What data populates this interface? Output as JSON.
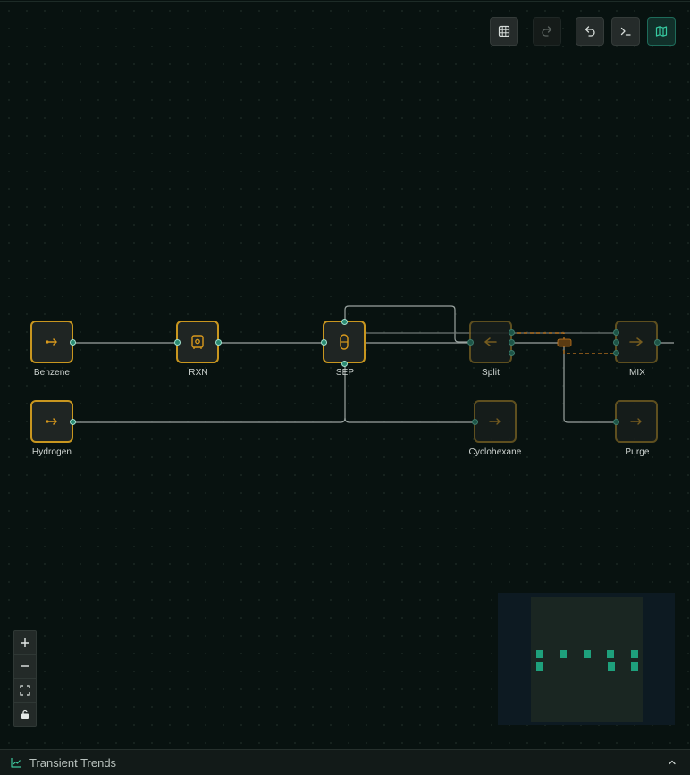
{
  "toolbar": {
    "buttons": [
      {
        "name": "grid-button",
        "icon": "grid-icon",
        "state": "normal"
      },
      {
        "name": "redo-button",
        "icon": "redo-icon",
        "state": "disabled"
      },
      {
        "name": "undo-button",
        "icon": "undo-icon",
        "state": "normal"
      },
      {
        "name": "console-button",
        "icon": "terminal-icon",
        "state": "normal"
      },
      {
        "name": "map-button",
        "icon": "map-icon",
        "state": "active"
      }
    ]
  },
  "nodes": {
    "benzene": {
      "label": "Benzene",
      "icon": "feed-arrow-icon"
    },
    "rxn": {
      "label": "RXN",
      "icon": "reactor-icon"
    },
    "sep": {
      "label": "SEP",
      "icon": "separator-icon"
    },
    "split": {
      "label": "Split",
      "icon": "splitter-icon"
    },
    "mix": {
      "label": "MIX",
      "icon": "mixer-icon"
    },
    "hydrogen": {
      "label": "Hydrogen",
      "icon": "feed-arrow-icon"
    },
    "cyclohexane": {
      "label": "Cyclohexane",
      "icon": "product-arrow-icon"
    },
    "purge": {
      "label": "Purge",
      "icon": "product-arrow-icon"
    }
  },
  "zoom_controls": [
    "zoom-in-icon",
    "zoom-out-icon",
    "fit-view-icon",
    "lock-icon"
  ],
  "bottom_panel": {
    "title": "Transient Trends",
    "icon": "line-chart-icon",
    "toggle_icon": "chevron-up-icon"
  },
  "colors": {
    "accent": "#1ea07c",
    "node_border": "#c8961f",
    "edge": "#9aa3a0",
    "recycle": "#c8791f"
  }
}
